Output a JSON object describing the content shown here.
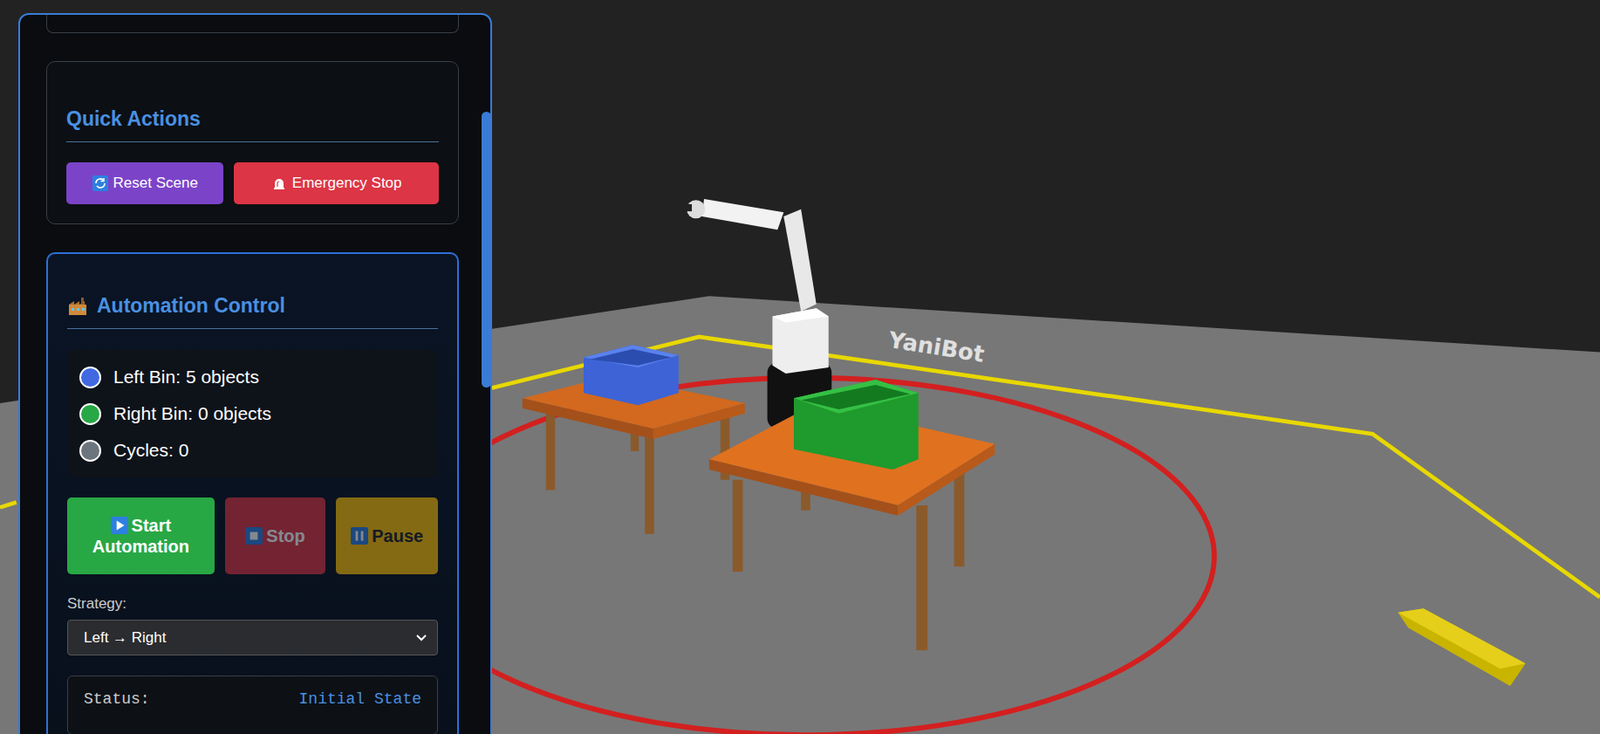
{
  "panel": {
    "quick_actions": {
      "title": "Quick Actions",
      "buttons": [
        {
          "label": "Reset Scene",
          "disabled": false
        },
        {
          "label": "Emergency Stop",
          "disabled": false
        }
      ]
    },
    "automation": {
      "title": "Automation Control",
      "stats": [
        {
          "label": "Left Bin: 5 objects",
          "color": "#4169e1"
        },
        {
          "label": "Right Bin: 0 objects",
          "color": "#28a745"
        },
        {
          "label": "Cycles: 0",
          "color": "#6c757d"
        }
      ],
      "buttons": [
        {
          "label": "Start Automation",
          "disabled": false
        },
        {
          "label": "Stop",
          "disabled": true
        },
        {
          "label": "Pause",
          "disabled": true
        }
      ],
      "strategy": {
        "label": "Strategy:",
        "value": "Left → Right"
      },
      "status": {
        "label": "Status:",
        "value": "Initial State"
      }
    }
  },
  "scene": {
    "floor_label": "YaniBot"
  }
}
